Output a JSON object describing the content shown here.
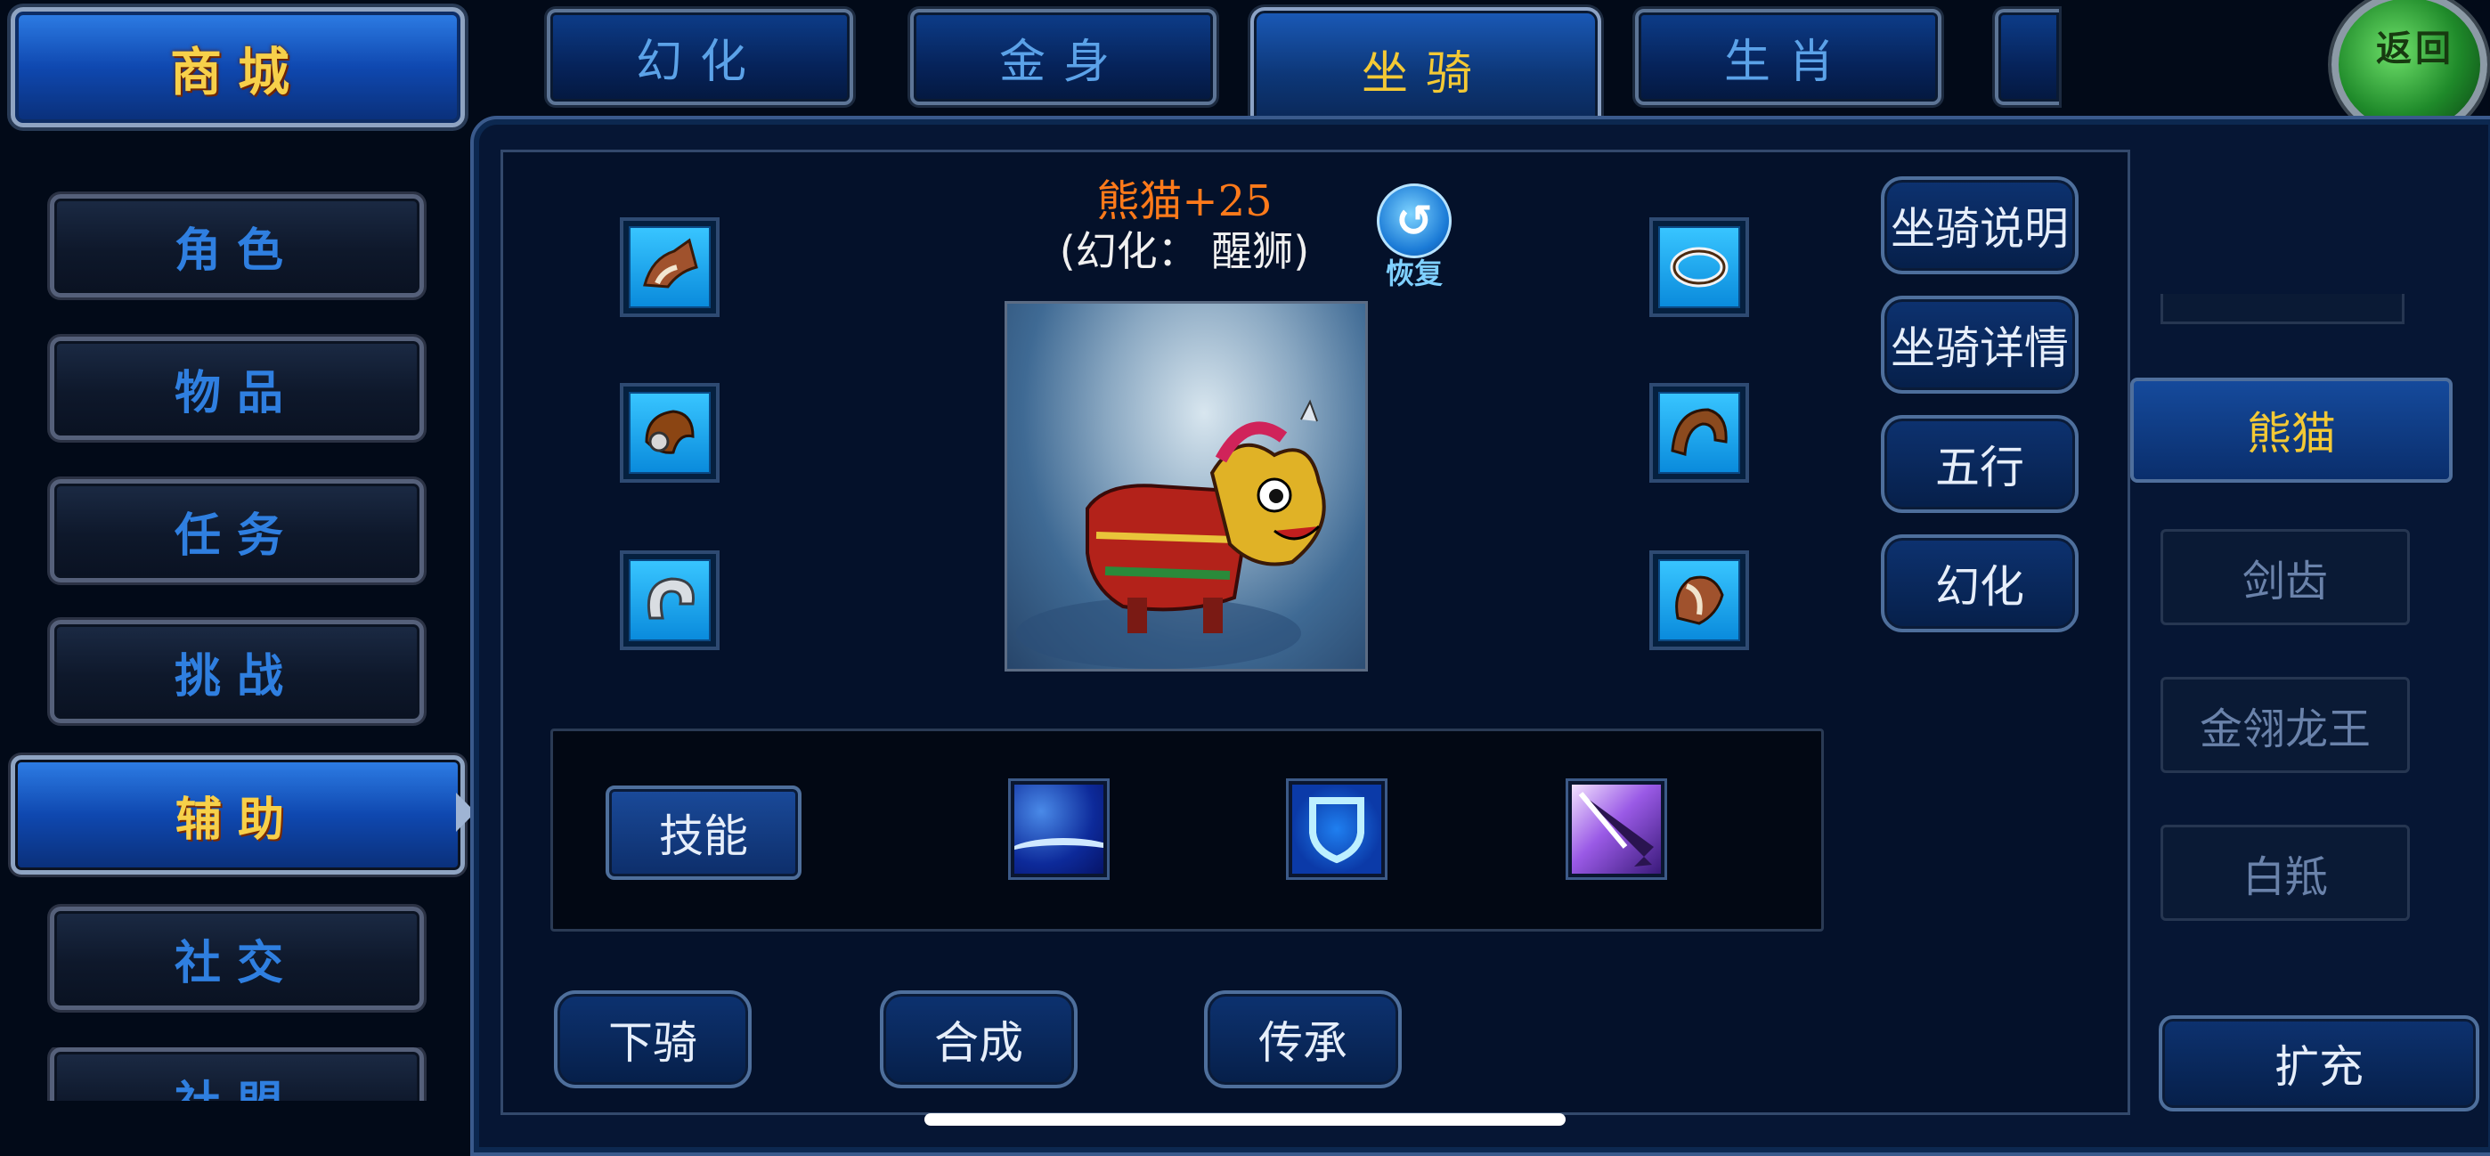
{
  "shop_button": {
    "label": "商城"
  },
  "back_button": {
    "label": "返回"
  },
  "tabs": [
    {
      "label": "幻化",
      "active": false
    },
    {
      "label": "金身",
      "active": false
    },
    {
      "label": "坐骑",
      "active": true
    },
    {
      "label": "生肖",
      "active": false
    }
  ],
  "sidebar": {
    "items": [
      {
        "label": "角色",
        "active": false
      },
      {
        "label": "物品",
        "active": false
      },
      {
        "label": "任务",
        "active": false
      },
      {
        "label": "挑战",
        "active": false
      },
      {
        "label": "辅助",
        "active": true
      },
      {
        "label": "社交",
        "active": false
      },
      {
        "label": "社盟",
        "active": false
      }
    ]
  },
  "mount": {
    "name": "熊猫+25",
    "transform": "(幻化： 醒狮)",
    "restore_label": "恢复"
  },
  "equipment_icons": {
    "left": [
      "saddle-icon",
      "stirrup-icon",
      "horseshoe-icon"
    ],
    "right": [
      "ring-icon",
      "horn-icon",
      "armor-icon"
    ]
  },
  "skills": {
    "label": "技能",
    "icons": [
      "water-skill-icon",
      "shield-skill-icon",
      "arrow-skill-icon"
    ]
  },
  "action_buttons": {
    "dismount": "下骑",
    "compose": "合成",
    "inherit": "传承"
  },
  "right_menu": {
    "info": "坐骑说明",
    "details": "坐骑详情",
    "five_elements": "五行",
    "transform": "幻化"
  },
  "mount_list": {
    "items": [
      {
        "name": "熊猫",
        "selected": true
      },
      {
        "name": "剑齿",
        "selected": false
      },
      {
        "name": "金翎龙王",
        "selected": false
      },
      {
        "name": "白羝",
        "selected": false
      }
    ],
    "expand_label": "扩充"
  },
  "colors": {
    "accent_gold": "#f3c935",
    "mount_name": "#ff7a1a",
    "tab_text": "#5ba2e8"
  }
}
